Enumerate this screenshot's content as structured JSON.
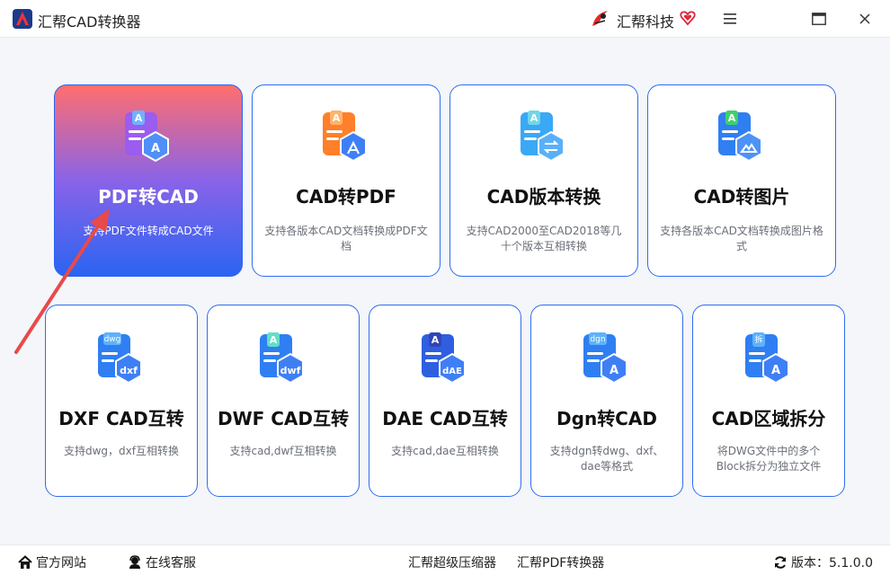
{
  "titlebar": {
    "app_title": "汇帮CAD转换器",
    "brand_name": "汇帮科技",
    "icons": [
      "app-logo-icon",
      "brand-logo-icon",
      "heart-icon",
      "menu-icon",
      "maximize-icon",
      "close-icon"
    ]
  },
  "cards": [
    {
      "id": "pdf-to-cad",
      "title": "PDF转CAD",
      "desc": "支持PDF文件转成CAD文件",
      "badge": "",
      "active": true
    },
    {
      "id": "cad-to-pdf",
      "title": "CAD转PDF",
      "desc": "支持各版本CAD文档转换成PDF文档",
      "badge": ""
    },
    {
      "id": "cad-version",
      "title": "CAD版本转换",
      "desc": "支持CAD2000至CAD2018等几十个版本互相转换",
      "badge": ""
    },
    {
      "id": "cad-to-image",
      "title": "CAD转图片",
      "desc": "支持各版本CAD文档转换成图片格式",
      "badge": ""
    },
    {
      "id": "dxf-cad",
      "title": "DXF CAD互转",
      "desc": "支持dwg，dxf互相转换",
      "badge": "dxf",
      "badge_top": "dwg"
    },
    {
      "id": "dwf-cad",
      "title": "DWF CAD互转",
      "desc": "支持cad,dwf互相转换",
      "badge": "dwf"
    },
    {
      "id": "dae-cad",
      "title": "DAE CAD互转",
      "desc": "支持cad,dae互相转换",
      "badge": "dAE"
    },
    {
      "id": "dgn-cad",
      "title": "Dgn转CAD",
      "desc": "支持dgn转dwg、dxf、dae等格式",
      "badge": "A",
      "badge_top": "dgn"
    },
    {
      "id": "cad-split",
      "title": "CAD区域拆分",
      "desc": "将DWG文件中的多个Block拆分为独立文件",
      "badge": "A",
      "badge_top": "拆"
    }
  ],
  "footer": {
    "website": "官方网站",
    "support": "在线客服",
    "compressor": "汇帮超级压缩器",
    "pdf_converter": "汇帮PDF转换器",
    "version": "版本：5.1.0.0"
  },
  "colors": {
    "accent": "#2f6df0",
    "active_top": "#ff6e6e",
    "active_bottom": "#2a64f2",
    "arrow": "#e84a4a"
  }
}
